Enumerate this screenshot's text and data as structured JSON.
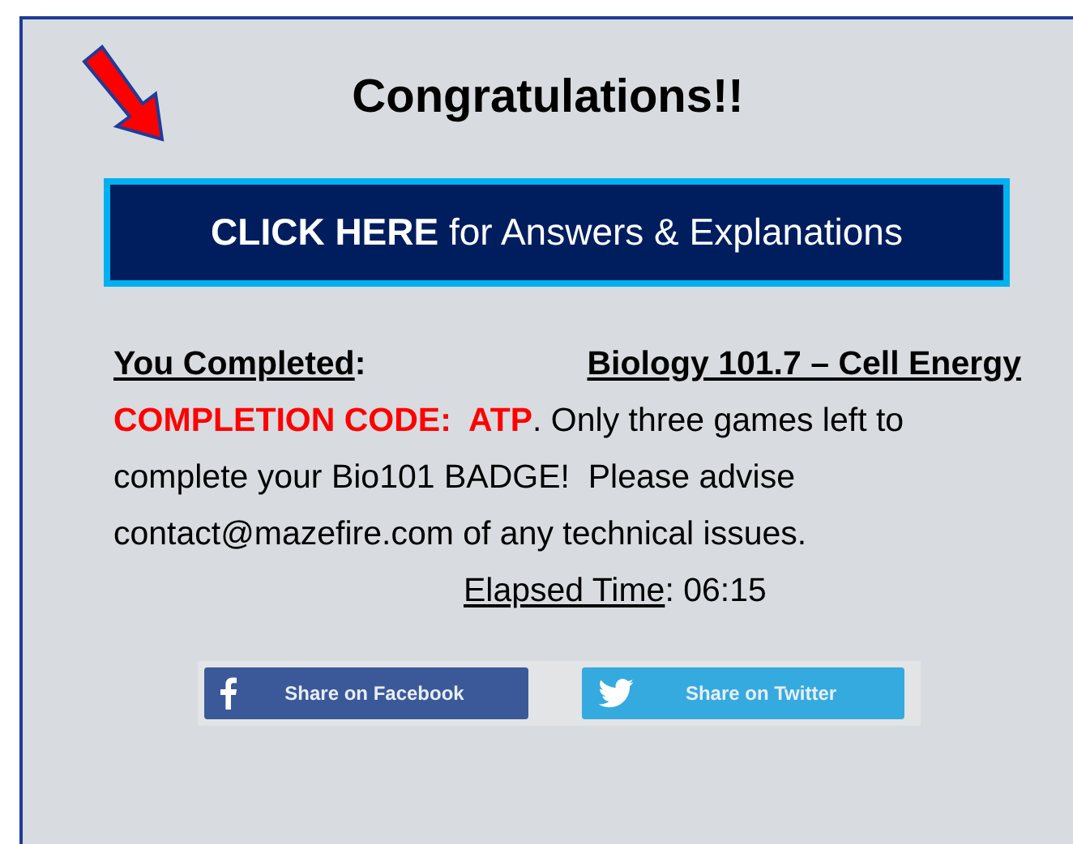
{
  "title": "Congratulations!!",
  "answers_button": "**CLICK HERE** for Answers & Explanations",
  "completed": {
    "label": "You Completed",
    "colon": ":",
    "course": "Biology 101.7 – Cell Energy"
  },
  "completion_code": "COMPLETION CODE:  ATP",
  "message": ". Only three games left to complete your Bio101 BADGE!  Please advise contact@mazefire.com of any technical issues.",
  "elapsed": {
    "label": "Elapsed Time",
    "value": ": 06:15"
  },
  "share_buttons": [
    {
      "kind": "facebook",
      "label": "Share on Facebook"
    },
    {
      "kind": "twitter",
      "label": "Share on Twitter"
    }
  ]
}
